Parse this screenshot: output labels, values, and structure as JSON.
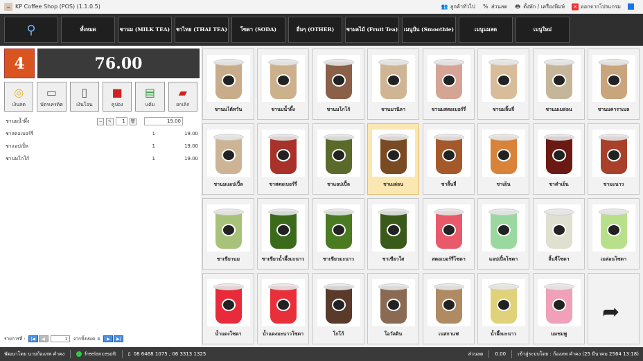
{
  "window": {
    "title": "KP Coffee Shop (POS) (1.1.0.5)"
  },
  "topbar": [
    {
      "label": "ลูกค้าทั่วไป",
      "icon": "customer-icon"
    },
    {
      "label": "ส่วนลด",
      "icon": "percent-icon"
    },
    {
      "label": "ตั้งพัก / เครื่องพิมพ์",
      "icon": "printer-icon"
    },
    {
      "label": "ออกจากโปรแกรม",
      "icon": "exit-icon"
    }
  ],
  "categories": [
    {
      "label": "ทั้งหมด"
    },
    {
      "label": "ชานม (MILK TEA)"
    },
    {
      "label": "ชาไทย (THAI TEA)"
    },
    {
      "label": "โซดา (SODA)"
    },
    {
      "label": "อื่นๆ (OTHER)"
    },
    {
      "label": "ชาผลไม้ (Fruit Tea)"
    },
    {
      "label": "เมนูปั่น (Smoothie)"
    },
    {
      "label": "เมนูนมสด"
    },
    {
      "label": "เมนูใหม่"
    }
  ],
  "order": {
    "item_count": "4",
    "total": "76.00",
    "items": [
      {
        "name": "ชานมน้ำผึ้ง",
        "qty": "1",
        "price": "19.00"
      },
      {
        "name": "ชาสตอเบอร์รี่",
        "qty": "1",
        "price": "19.00"
      },
      {
        "name": "ชาแอปเปิ้ล",
        "qty": "1",
        "price": "19.00"
      },
      {
        "name": "ชานมโกโก้",
        "qty": "1",
        "price": "19.00"
      }
    ]
  },
  "payments": [
    {
      "label": "เงินสด",
      "icon": "coins-icon",
      "color": "#e8b020"
    },
    {
      "label": "บัตรเครดิต",
      "icon": "credit-card-icon",
      "color": "#555555"
    },
    {
      "label": "เงินโอน",
      "icon": "mobile-icon",
      "color": "#555555"
    },
    {
      "label": "คูปอง",
      "icon": "coupon-icon",
      "color": "#d02020"
    },
    {
      "label": "แต้ม",
      "icon": "points-icon",
      "color": "#2a9a3a"
    },
    {
      "label": "ยกเลิก",
      "icon": "eraser-icon",
      "color": "#d02020"
    }
  ],
  "pager": {
    "label": "รายการที่ :",
    "page": "1",
    "of_label": "จากทั้งหมด",
    "total": "4"
  },
  "products": [
    {
      "name": "ชานมไต้หวัน",
      "color": "#c9ad8a"
    },
    {
      "name": "ชานมน้ำผึ้ง",
      "color": "#cdb08c"
    },
    {
      "name": "ชานมโกโก้",
      "color": "#8a6048"
    },
    {
      "name": "ชานมวนิลา",
      "color": "#cfb593"
    },
    {
      "name": "ชานมสตอเบอร์รี่",
      "color": "#d6a494"
    },
    {
      "name": "ชานมลิ้นจี่",
      "color": "#d9bc9a"
    },
    {
      "name": "ชานมเมล่อน",
      "color": "#c5b69a"
    },
    {
      "name": "ชานมคาราเมล",
      "color": "#c9a57d"
    },
    {
      "name": "ชานมแอปเปิ้ล",
      "color": "#cdb495"
    },
    {
      "name": "ชาสตอเบอร์รี่",
      "color": "#a8322a"
    },
    {
      "name": "ชาแอปเปิ้ล",
      "color": "#5a6a2a"
    },
    {
      "name": "ชาเมล่อน",
      "color": "#7a4a22",
      "selected": true
    },
    {
      "name": "ชาลิ้นจี่",
      "color": "#a5582a"
    },
    {
      "name": "ชาเย็น",
      "color": "#d9823a"
    },
    {
      "name": "ชาดำเย็น",
      "color": "#6a1a12"
    },
    {
      "name": "ชามะนาว",
      "color": "#a8402a"
    },
    {
      "name": "ชาเขียวนม",
      "color": "#a8c27a"
    },
    {
      "name": "ชาเขียวน้ำผึ้งมะนาว",
      "color": "#3a6a1a"
    },
    {
      "name": "ชาเขียวมะนาว",
      "color": "#4a7a22"
    },
    {
      "name": "ชาเขียวใส",
      "color": "#3a5a1a"
    },
    {
      "name": "สตอเบอร์รี่โซดา",
      "color": "#e85a6a"
    },
    {
      "name": "แอปเปิ้ลโซดา",
      "color": "#9ad8a0"
    },
    {
      "name": "ลิ้นจี่โซดา",
      "color": "#e0e0d0"
    },
    {
      "name": "เมล่อนโซดา",
      "color": "#b8e08a"
    },
    {
      "name": "น้ำแดงโซดา",
      "color": "#e82a3a"
    },
    {
      "name": "น้ำแดงมะนาวโซดา",
      "color": "#e8303a"
    },
    {
      "name": "โกโก้",
      "color": "#5a3a2a"
    },
    {
      "name": "โอวัลติน",
      "color": "#8a6a52"
    },
    {
      "name": "เนสกาแฟ",
      "color": "#b08a62"
    },
    {
      "name": "น้ำผึ้งมะนาว",
      "color": "#e0d27a"
    },
    {
      "name": "นมชมพู",
      "color": "#f0a0b8"
    }
  ],
  "status": {
    "dev": "พัฒนาโดย นายก้องภพ คำคง",
    "line": "freelancesoft",
    "phone": "08 6468 1075 , 06 3313 1325",
    "discount_label": "ส่วนลด",
    "discount_value": "0.00",
    "user": "เข้าสู่ระบบโดย : ก้องภพ คำคง (25 มีนาคม 2564 13:18)"
  }
}
